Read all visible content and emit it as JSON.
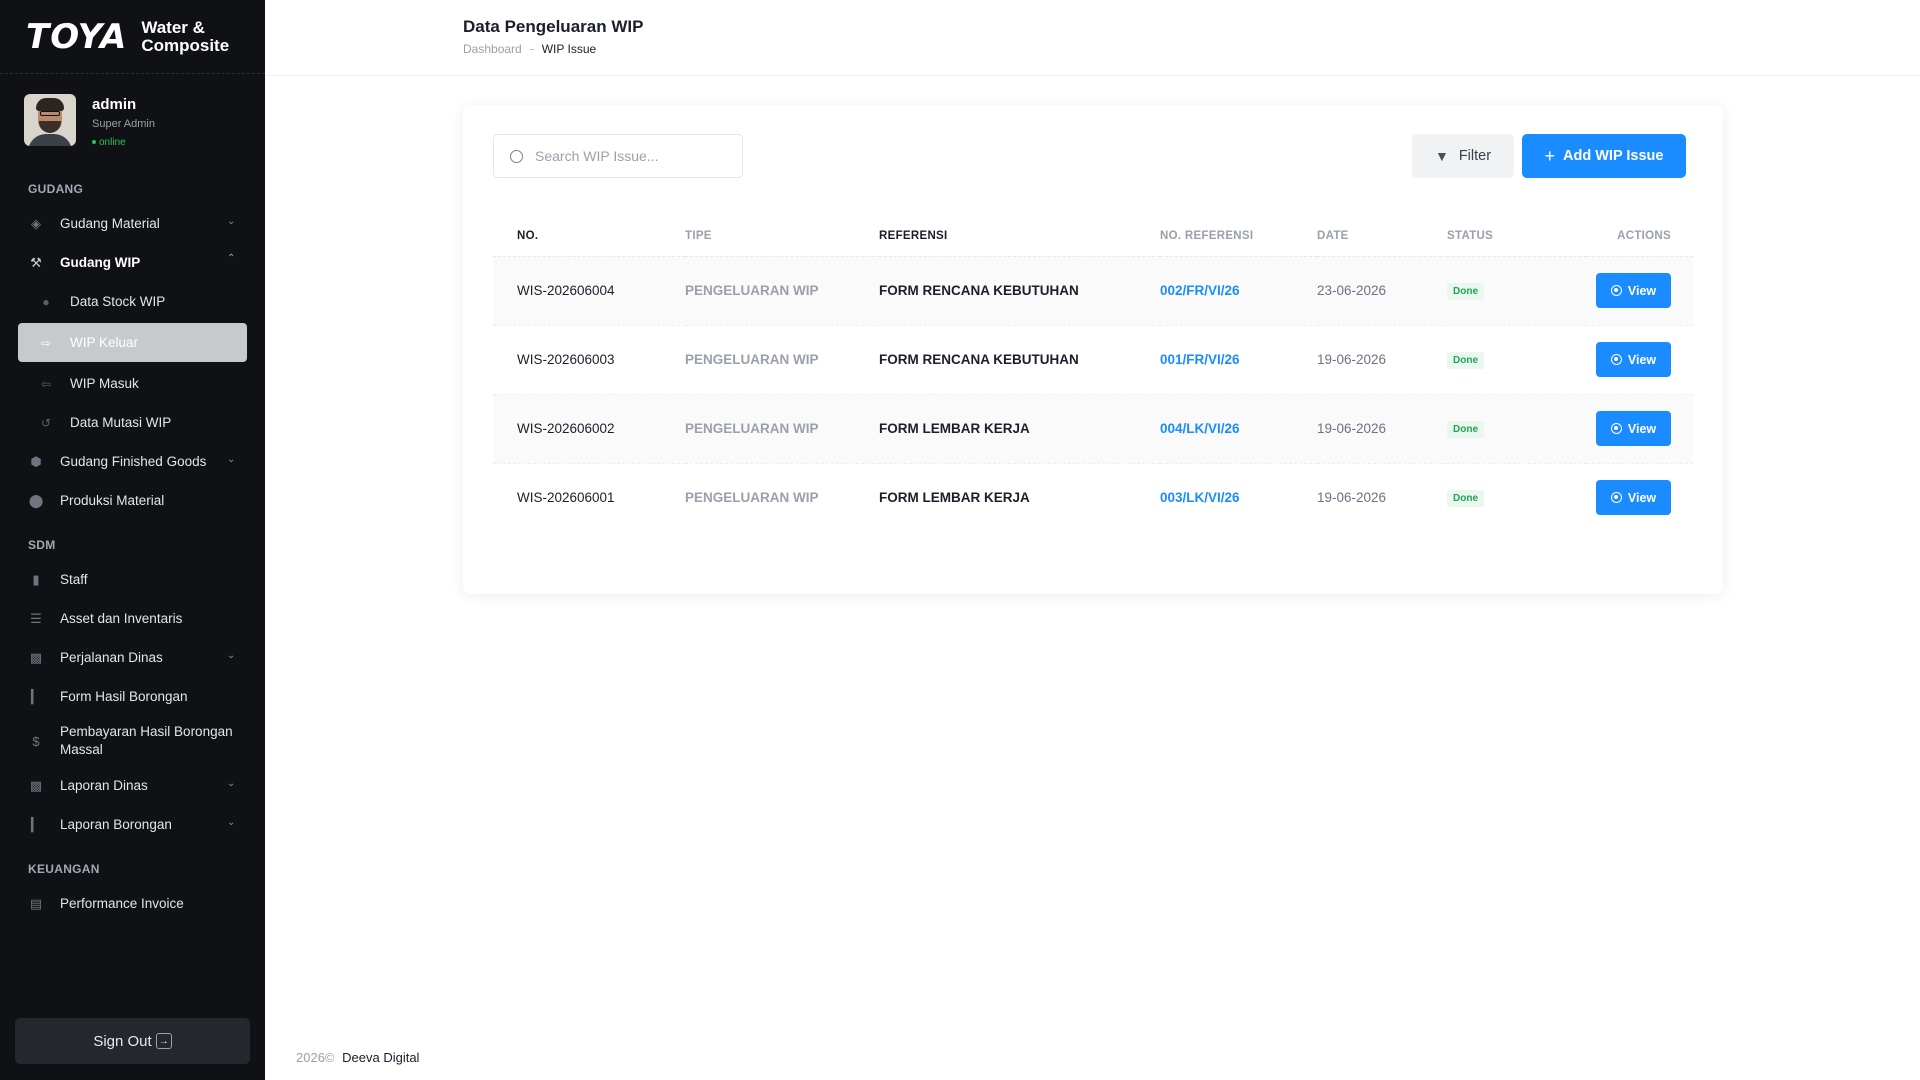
{
  "sidebar": {
    "logo_mark": "TOYA",
    "logo_line1": "Water &",
    "logo_line2": "Composite",
    "user": {
      "name": "admin",
      "role": "Super Admin",
      "status": "online"
    },
    "sections": {
      "gudang": "GUDANG",
      "sdm": "SDM",
      "keuangan": "KEUANGAN"
    },
    "items": {
      "gudang_material": "Gudang Material",
      "gudang_wip": "Gudang WIP",
      "data_stock_wip": "Data Stock WIP",
      "wip_keluar": "WIP Keluar",
      "wip_masuk": "WIP Masuk",
      "data_mutasi_wip": "Data Mutasi WIP",
      "gudang_finished_goods": "Gudang Finished Goods",
      "produksi_material": "Produksi Material",
      "staff": "Staff",
      "asset_inventaris": "Asset dan Inventaris",
      "perjalanan_dinas": "Perjalanan Dinas",
      "form_hasil_borongan": "Form Hasil Borongan",
      "pembayaran_line1": "Pembayaran Hasil Borongan",
      "pembayaran_line2": "Massal",
      "laporan_dinas": "Laporan Dinas",
      "laporan_borongan": "Laporan Borongan",
      "performance_invoice": "Performance Invoice"
    },
    "signout_label": "Sign Out"
  },
  "header": {
    "title": "Data Pengeluaran WIP",
    "breadcrumb": {
      "root": "Dashboard",
      "current": "WIP Issue"
    }
  },
  "toolbar": {
    "search_placeholder": "Search WIP Issue...",
    "filter_label": "Filter",
    "add_label": "Add WIP Issue"
  },
  "table": {
    "columns": {
      "no": "NO.",
      "tipe": "TIPE",
      "referensi": "REFERENSI",
      "no_referensi": "NO. REFERENSI",
      "date": "DATE",
      "status": "STATUS",
      "actions": "ACTIONS"
    },
    "view_label": "View",
    "rows": [
      {
        "no": "WIS-202606004",
        "tipe": "PENGELUARAN WIP",
        "referensi": "FORM RENCANA KEBUTUHAN",
        "no_referensi": "002/FR/VI/26",
        "date": "23-06-2026",
        "status": "Done"
      },
      {
        "no": "WIS-202606003",
        "tipe": "PENGELUARAN WIP",
        "referensi": "FORM RENCANA KEBUTUHAN",
        "no_referensi": "001/FR/VI/26",
        "date": "19-06-2026",
        "status": "Done"
      },
      {
        "no": "WIS-202606002",
        "tipe": "PENGELUARAN WIP",
        "referensi": "FORM LEMBAR KERJA",
        "no_referensi": "004/LK/VI/26",
        "date": "19-06-2026",
        "status": "Done"
      },
      {
        "no": "WIS-202606001",
        "tipe": "PENGELUARAN WIP",
        "referensi": "FORM LEMBAR KERJA",
        "no_referensi": "003/LK/VI/26",
        "date": "19-06-2026",
        "status": "Done"
      }
    ]
  },
  "footer": {
    "year": "2026©",
    "brand": "Deeva Digital"
  },
  "colors": {
    "accent": "#1a8cff",
    "sidebar_bg": "#101114",
    "status_done": "#22a35a"
  }
}
